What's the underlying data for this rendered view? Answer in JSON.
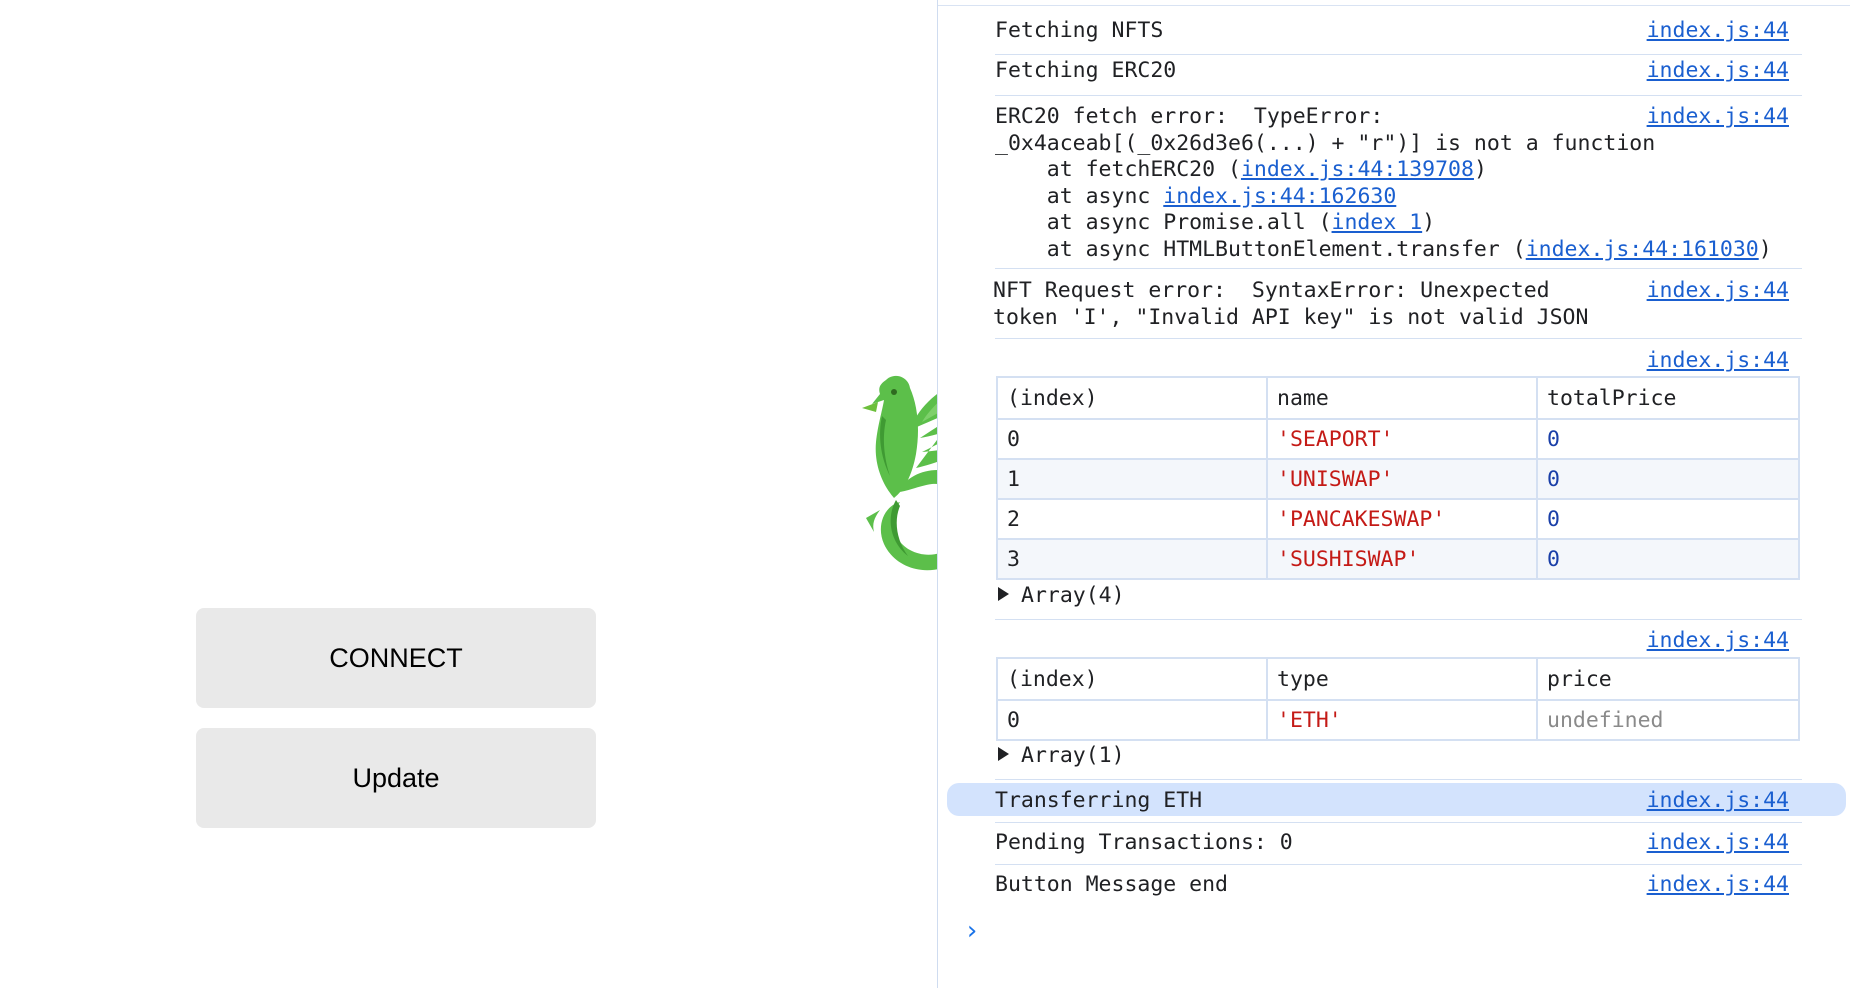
{
  "page": {
    "buttons": {
      "connect": "CONNECT",
      "update": "Update"
    }
  },
  "console": {
    "source": "index.js:44",
    "messages": [
      {
        "text": "Fetching NFTS"
      },
      {
        "text": "Fetching ERC20"
      }
    ],
    "erc20_error": {
      "line1": "ERC20 fetch error:  TypeError:",
      "line2": "_0x4aceab[(_0x26d3e6(...) + \"r\")] is not a function",
      "s1_pre": "    at fetchERC20 (",
      "s1_link": "index.js:44:139708",
      "s1_post": ")",
      "s2_pre": "    at async ",
      "s2_link": "index.js:44:162630",
      "s3_pre": "    at async Promise.all (",
      "s3_link": "index 1",
      "s3_post": ")",
      "s4_pre": "    at async HTMLButtonElement.transfer (",
      "s4_link": "index.js:44:161030",
      "s4_post": ")"
    },
    "nft_error": {
      "line1": "NFT Request error:  SyntaxError: Unexpected",
      "line2": "token 'I', \"Invalid API key\" is not valid JSON"
    },
    "table1": {
      "headers": [
        "(index)",
        "name",
        "totalPrice"
      ],
      "rows": [
        [
          "0",
          "'SEAPORT'",
          "0"
        ],
        [
          "1",
          "'UNISWAP'",
          "0"
        ],
        [
          "2",
          "'PANCAKESWAP'",
          "0"
        ],
        [
          "3",
          "'SUSHISWAP'",
          "0"
        ]
      ],
      "array_label": "Array(4)"
    },
    "table2": {
      "headers": [
        "(index)",
        "type",
        "price"
      ],
      "rows": [
        [
          "0",
          "'ETH'",
          "undefined"
        ]
      ],
      "array_label": "Array(1)"
    },
    "tail_messages": [
      {
        "text": "Transferring ETH"
      },
      {
        "text": "Pending Transactions: 0"
      },
      {
        "text": "Button Message end"
      }
    ],
    "prompt": "›"
  },
  "colors": {
    "link": "#1a5fd0",
    "string": "#c41a16",
    "number": "#1a3fa8",
    "highlight": "#d3e3fd",
    "button": "#e9e9e9",
    "bird": "#5cbf4a"
  }
}
